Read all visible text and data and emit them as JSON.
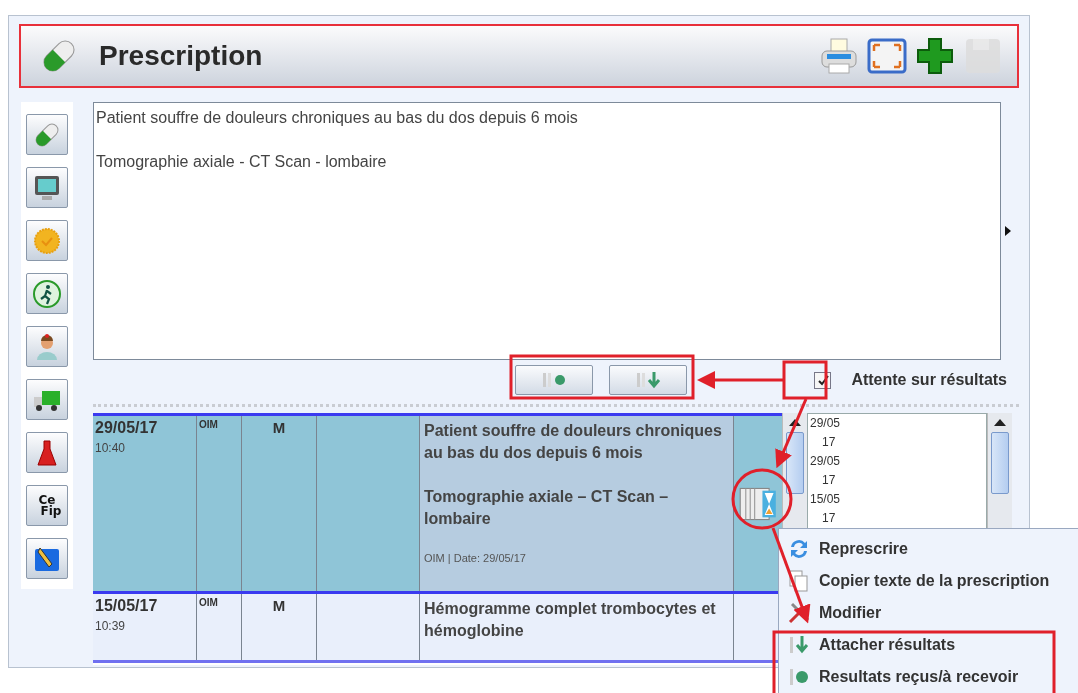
{
  "header": {
    "title": "Prescription"
  },
  "toolbar": [
    {
      "kind": "print",
      "disabled": false
    },
    {
      "kind": "fullscreen",
      "disabled": false
    },
    {
      "kind": "add",
      "disabled": false
    },
    {
      "kind": "save",
      "disabled": true
    }
  ],
  "sidebar": {
    "items": [
      {
        "kind": "pill"
      },
      {
        "kind": "monitor"
      },
      {
        "kind": "medal"
      },
      {
        "kind": "runner"
      },
      {
        "kind": "nurse"
      },
      {
        "kind": "truck"
      },
      {
        "kind": "flask"
      },
      {
        "kind": "cefip"
      },
      {
        "kind": "pen"
      }
    ]
  },
  "cefip_label": [
    "Ce",
    "Fip"
  ],
  "note": {
    "lines": [
      "Patient souffre de douleurs chroniques au bas du dos depuis 6 mois",
      "Tomographie axiale - CT Scan - lombaire"
    ]
  },
  "actions": [
    {
      "kind": "received"
    },
    {
      "kind": "attach"
    }
  ],
  "waiting_checkbox": {
    "label": "Attente sur résultats",
    "checked": true
  },
  "table": {
    "rows": [
      {
        "date": "29/05/17",
        "time": "10:40",
        "column_2": "OIM",
        "column_3": "M",
        "paragraphs": [
          "Patient souffre de douleurs chroniques au bas du dos depuis 6 mois",
          "Tomographie axiale – CT Scan – lombaire"
        ],
        "footer": "OIM | Date: 29/05/17",
        "pending": true,
        "selected": true
      },
      {
        "date": "15/05/17",
        "time": "10:39",
        "column_2": "OIM",
        "column_3": "M",
        "paragraphs": [
          "Hémogramme complet trombocytes et hémoglobine"
        ],
        "footer": "",
        "pending": false,
        "selected": false
      }
    ]
  },
  "side_list": {
    "items": [
      {
        "day": "29/05",
        "year": "17"
      },
      {
        "day": "29/05",
        "year": "17"
      },
      {
        "day": "15/05",
        "year": "17"
      }
    ]
  },
  "context_menu": {
    "items": [
      {
        "kind": "represcribe",
        "label": "Represcrire"
      },
      {
        "kind": "copy",
        "label": "Copier texte de la prescription"
      },
      {
        "kind": "edit",
        "label": "Modifier"
      },
      {
        "kind": "attach",
        "label": "Attacher résultats"
      },
      {
        "kind": "received",
        "label": "Resultats reçus/à recevoir"
      }
    ]
  }
}
